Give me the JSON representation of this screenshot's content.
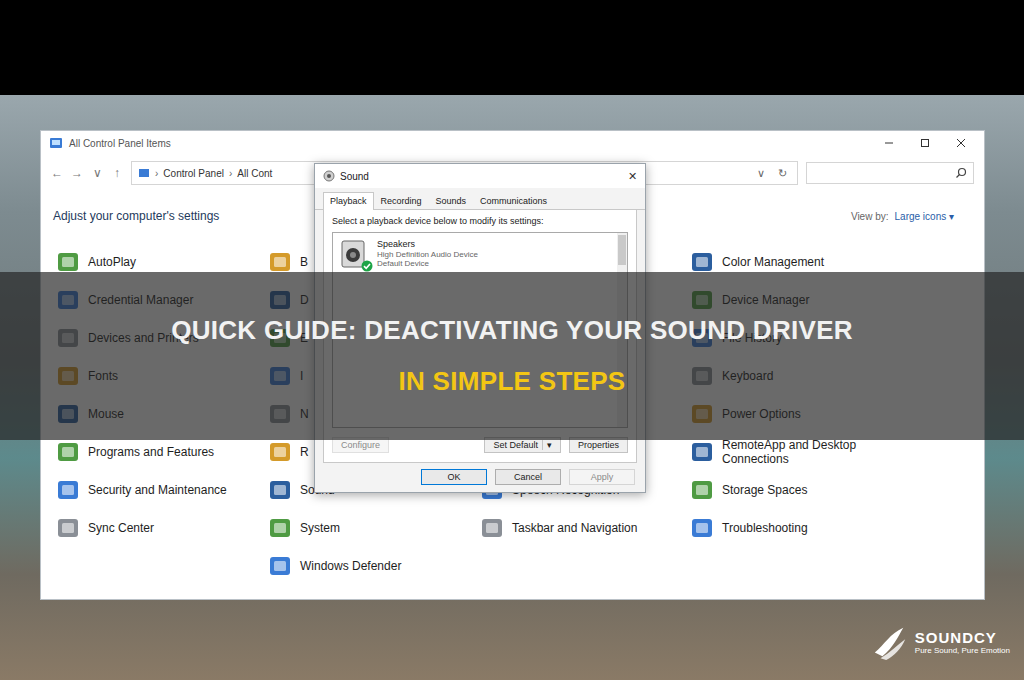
{
  "banner": {
    "line1": "QUICK GUIDE: DEACTIVATING YOUR SOUND DRIVER",
    "line2": "IN SIMPLE STEPS"
  },
  "logo": {
    "name": "SOUNDCY",
    "tagline": "Pure Sound, Pure Emotion"
  },
  "window": {
    "title": "All Control Panel Items",
    "nav": [
      "←",
      "→",
      "∨",
      "↑"
    ],
    "address": [
      "Control Panel",
      "All Cont"
    ],
    "address_separator": "›",
    "address_controls": [
      "∨",
      "↻"
    ]
  },
  "content": {
    "heading": "Adjust your computer's settings",
    "view_by": {
      "label": "View by:",
      "value": "Large icons",
      "arrow": "▾"
    }
  },
  "columns": [
    {
      "items": [
        "AutoPlay",
        "Credential Manager",
        "Devices and Printers",
        "Fonts",
        "Mouse",
        "Programs and Features",
        "Security and Maintenance",
        "Sync Center"
      ]
    },
    {
      "items": [
        "B",
        "D",
        "E",
        "I",
        "N",
        "R",
        "Sound",
        "System",
        "Windows Defender"
      ]
    },
    {
      "items": [
        "Speech Recognition",
        "Taskbar and Navigation"
      ]
    },
    {
      "items": [
        "Color Management",
        "Device Manager",
        "File History",
        "Keyboard",
        "Power Options",
        "RemoteApp and Desktop Connections",
        "Storage Spaces",
        "Troubleshooting"
      ]
    }
  ],
  "dialog": {
    "title": "Sound",
    "close": "✕",
    "tabs": [
      {
        "label": "Playback",
        "selected": true
      },
      {
        "label": "Recording",
        "selected": false
      },
      {
        "label": "Sounds",
        "selected": false
      },
      {
        "label": "Communications",
        "selected": false
      }
    ],
    "instruction": "Select a playback device below to modify its settings:",
    "devices": [
      {
        "name": "Speakers",
        "description": "High Definition Audio Device",
        "status": "Default Device",
        "default": true,
        "selected": false
      }
    ],
    "buttons": [
      {
        "label": "Configure",
        "disabled": true,
        "menu": ""
      },
      {
        "label": "Set Default",
        "disabled": false,
        "menu": "▾"
      },
      {
        "label": "Properties",
        "disabled": false,
        "menu": ""
      }
    ],
    "footer": [
      {
        "label": "OK",
        "disabled": false,
        "default": true
      },
      {
        "label": "Cancel",
        "disabled": false,
        "default": false
      },
      {
        "label": "Apply",
        "disabled": true,
        "default": false
      }
    ]
  }
}
